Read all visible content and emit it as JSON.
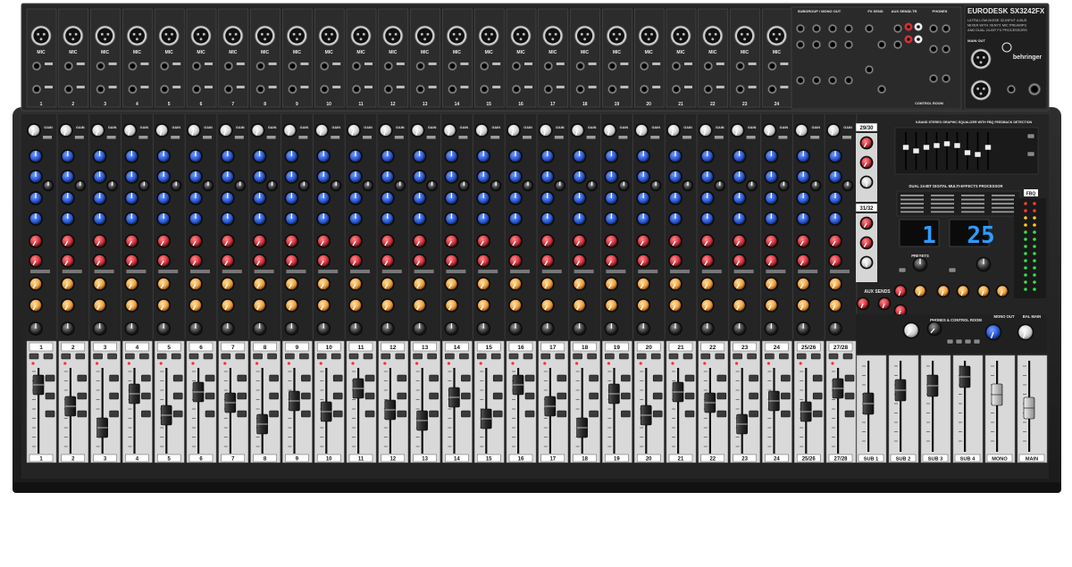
{
  "brand": {
    "model_name": "EURODESK SX3242FX",
    "tagline_lines": [
      "ULTRA LOW-NOISE 32-INPUT 4-BUS",
      "MIXER WITH XENYX MIC PREAMPS",
      "AND DUAL 24-BIT FX PROCESSORS"
    ],
    "logo_text": "behringer"
  },
  "rear_panel_labels": {
    "subgroup_section": "SUBGROUP / MONO OUT",
    "fx_send": "FX SEND",
    "aux_send": "AUX SEND",
    "two_track": "2-TR",
    "phones": "PHONES",
    "main_out": "MAIN OUT",
    "insert": "INSERT",
    "main_mix": "MAIN MIX",
    "control_room": "CONTROL ROOM"
  },
  "channel_strip_labels": {
    "mic": "MIC",
    "line": "LINE",
    "gain": "GAIN",
    "low_cut": "LOW CUT",
    "eq_hi": "HI",
    "eq_hi_mid": "HI MID",
    "eq_lo_mid": "LO MID",
    "eq_low": "LOW",
    "aux": "AUX",
    "fx": "FX",
    "pan": "PAN",
    "mute": "MUTE",
    "solo": "SOLO",
    "bus_1_2": "1-2",
    "bus_3_4": "3-4"
  },
  "input_channels": [
    "1",
    "2",
    "3",
    "4",
    "5",
    "6",
    "7",
    "8",
    "9",
    "10",
    "11",
    "12",
    "13",
    "14",
    "15",
    "16",
    "17",
    "18",
    "19",
    "20",
    "21",
    "22",
    "23",
    "24",
    "25/26",
    "27/28"
  ],
  "stereo_returns": {
    "return_a": "29/30",
    "return_b": "31/32",
    "aux_sends_label": "AUX SENDS"
  },
  "master_fader_labels": [
    "SUB 1",
    "SUB 2",
    "SUB 3",
    "SUB 4",
    "MONO",
    "MAIN"
  ],
  "geq": {
    "title": "9-BAND STEREO GRAPHIC EQUALIZER WITH FBQ FEEDBACK DETECTION",
    "fbq_label": "FBQ"
  },
  "fx_section": {
    "title": "DUAL 24-BIT DIGITAL MULTI-EFFECTS PROCESSOR",
    "preset_a": "1",
    "preset_b": "25",
    "presets_label": "PRESETS"
  },
  "monitor_section": {
    "phones_control_room": "PHONES & CONTROL ROOM",
    "mono_out": "MONO OUT",
    "bal_main": "BAL MAIN"
  },
  "colors": {
    "chassis": "#202020",
    "panel": "#2b2b2b",
    "label_white": "#e8e8e8",
    "eq_knob": "#2c5ad8",
    "aux_knob": "#d2343c",
    "fx_knob": "#f0a03c",
    "led_display": "#2f9cff",
    "fader_strip": "#d9d9d9"
  },
  "icons": [
    "xlr-jack-icon",
    "trs-jack-icon",
    "rca-jack-icon",
    "knob-icon",
    "fader-cap-icon",
    "led-meter-icon",
    "seven-segment-display-icon",
    "button-icon"
  ]
}
